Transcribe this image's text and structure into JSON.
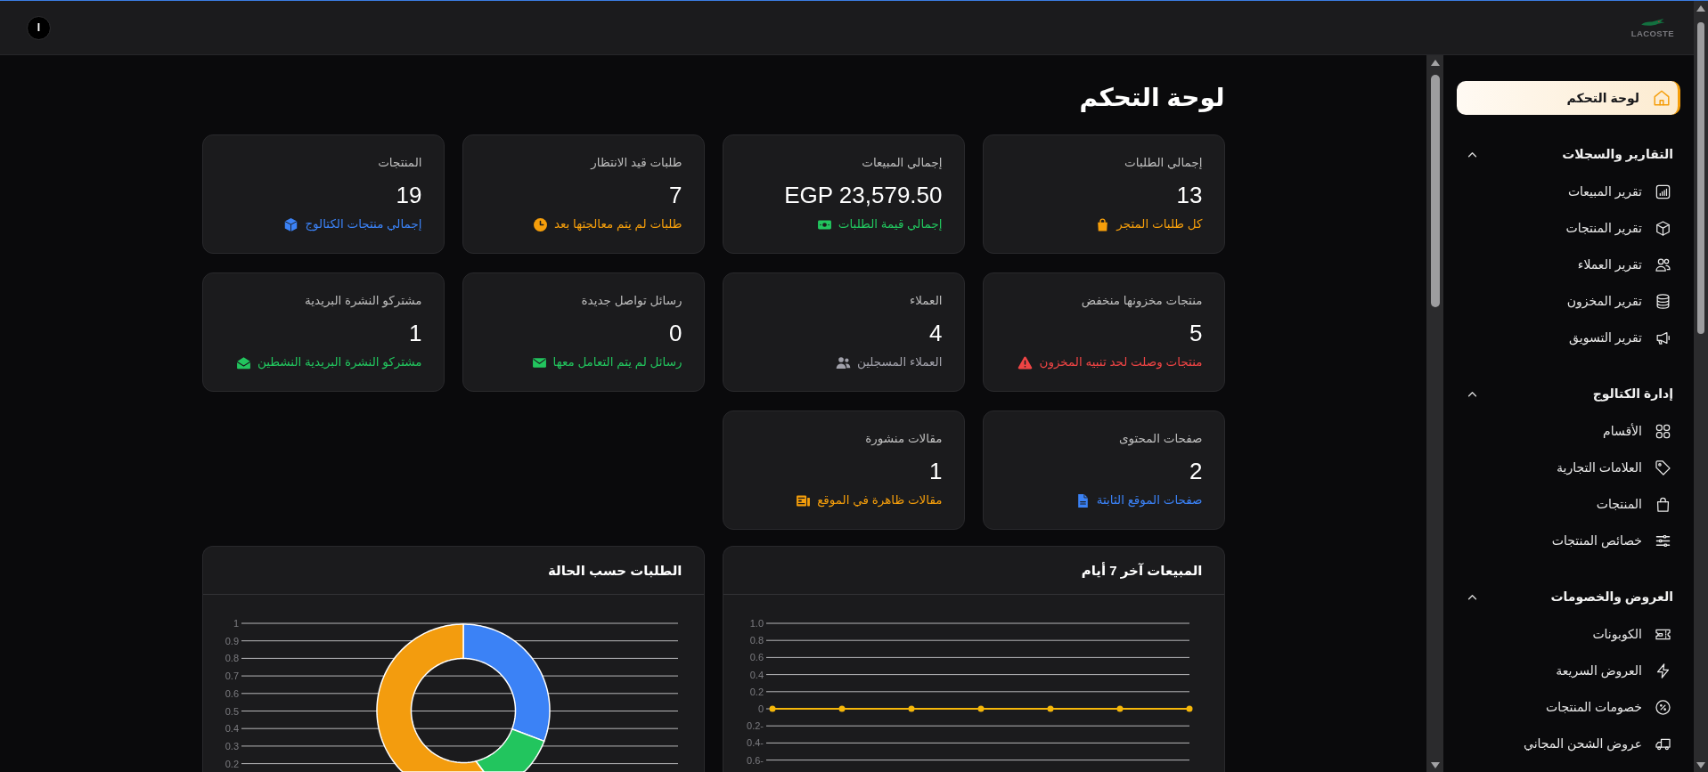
{
  "topbar": {
    "logo_text": "LACOSTE",
    "user_initial": "I"
  },
  "sidebar": {
    "dashboard_link": {
      "label": "لوحة التحكم",
      "selected": true
    },
    "sections": [
      {
        "title": "التقارير والسجلات",
        "expanded": true,
        "items": [
          {
            "label": "تقرير المبيعات",
            "selected": false
          },
          {
            "label": "تقرير المنتجات",
            "selected": false
          },
          {
            "label": "تقرير العملاء",
            "selected": false
          },
          {
            "label": "تقرير المخزون",
            "selected": false
          },
          {
            "label": "تقرير التسويق",
            "selected": false
          }
        ]
      },
      {
        "title": "إدارة الكتالوج",
        "expanded": true,
        "items": [
          {
            "label": "الأقسام",
            "selected": false
          },
          {
            "label": "العلامات التجارية",
            "selected": false
          },
          {
            "label": "المنتجات",
            "selected": false
          },
          {
            "label": "خصائص المنتجات",
            "selected": false
          }
        ]
      },
      {
        "title": "العروض والخصومات",
        "expanded": true,
        "items": [
          {
            "label": "الكوبونات",
            "selected": false
          },
          {
            "label": "العروض السريعة",
            "selected": false
          },
          {
            "label": "خصومات المنتجات",
            "selected": false
          },
          {
            "label": "عروض الشحن المجاني",
            "selected": false
          }
        ]
      }
    ]
  },
  "page_title": "لوحة التحكم",
  "stats": [
    {
      "title": "إجمالي الطلبات",
      "value": "13",
      "note": "كل طلبات المتجر",
      "color": "#f59e0b"
    },
    {
      "title": "إجمالي المبيعات",
      "value": "EGP 23,579.50",
      "note": "إجمالي قيمة الطلبات",
      "color": "#22c55e"
    },
    {
      "title": "طلبات قيد الانتظار",
      "value": "7",
      "note": "طلبات لم يتم معالجتها بعد",
      "color": "#f59e0b"
    },
    {
      "title": "المنتجات",
      "value": "19",
      "note": "إجمالي منتجات الكتالوج",
      "color": "#3b82f6"
    },
    {
      "title": "منتجات مخزونها منخفض",
      "value": "5",
      "note": "منتجات وصلت لحد تنبيه المخزون",
      "color": "#ef4444"
    },
    {
      "title": "العملاء",
      "value": "4",
      "note": "العملاء المسجلين",
      "color": "#a1a1aa"
    },
    {
      "title": "رسائل تواصل جديدة",
      "value": "0",
      "note": "رسائل لم يتم التعامل معها",
      "color": "#22c55e"
    },
    {
      "title": "مشتركو النشرة البريدية",
      "value": "1",
      "note": "مشتركو النشرة البريدية النشطين",
      "color": "#22c55e"
    },
    {
      "title": "صفحات المحتوى",
      "value": "2",
      "note": "صفحات الموقع الثابتة",
      "color": "#3b82f6"
    },
    {
      "title": "مقالات منشورة",
      "value": "1",
      "note": "مقالات ظاهرة في الموقع",
      "color": "#f59e0b"
    }
  ],
  "sales_chart": {
    "chart_data": {
      "type": "line",
      "title": "المبيعات آخر 7 أيام",
      "ylim": [
        -0.6,
        1
      ],
      "yticks": [
        {
          "value": 1,
          "label": "1.0"
        },
        0.8,
        0.6,
        0.4,
        0.2,
        0,
        {
          "value": -0.2,
          "label": "0.2-"
        },
        {
          "value": -0.4,
          "label": "0.4-"
        },
        {
          "value": -0.6,
          "label": "0.6-"
        }
      ],
      "grid": true,
      "series": [
        {
          "color": "#f5b70a",
          "marker": true,
          "values": [
            0,
            0,
            0,
            0,
            0,
            0,
            0
          ]
        }
      ]
    }
  },
  "status_chart": {
    "title": "الطلبات حسب الحالة",
    "axis_labels": [
      "1",
      "0.9",
      "0.8",
      "0.7",
      "0.6",
      "0.5",
      "0.4",
      "0.3",
      "0.2"
    ]
  }
}
